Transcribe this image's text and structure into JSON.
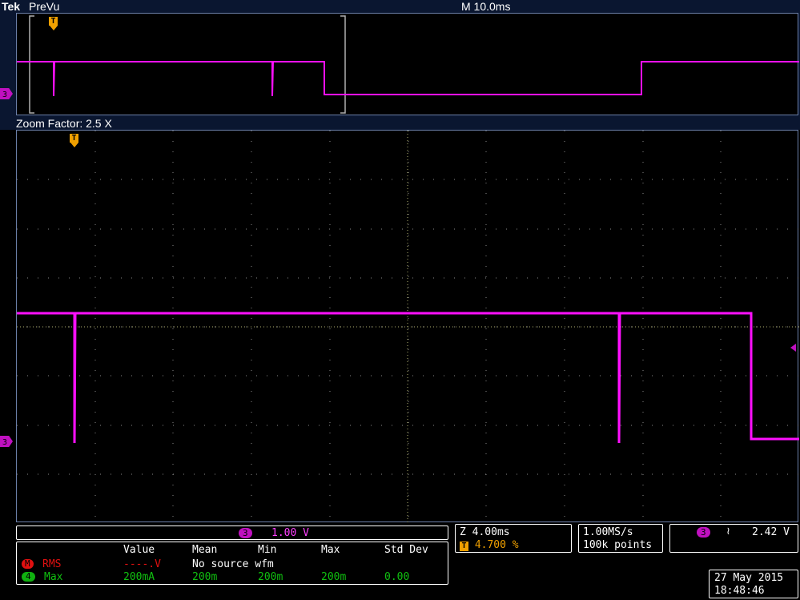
{
  "header": {
    "brand": "Tek",
    "mode": "PreVu",
    "timebase": "M 10.0ms"
  },
  "zoom": {
    "label": "Zoom Factor: 2.5 X"
  },
  "markers": {
    "trigger": "T",
    "channel": "3"
  },
  "channel_readout": {
    "channel": "3",
    "scale": "1.00 V"
  },
  "zoom_readout": {
    "zoom_time": "Z 4.00ms",
    "trigger_badge": "T",
    "trigger_pos": "4.700 %"
  },
  "acquisition": {
    "sample_rate": "1.00MS/s",
    "record_length": "100k points"
  },
  "trigger_readout": {
    "channel": "3",
    "slope_symbol": "≀",
    "level": "2.42 V"
  },
  "measurements": {
    "headers": [
      "Value",
      "Mean",
      "Min",
      "Max",
      "Std Dev"
    ],
    "rows": [
      {
        "badge": "M",
        "name": "RMS",
        "value": "----.V",
        "note": "No source wfm",
        "mean": "",
        "min": "",
        "max": "",
        "std": ""
      },
      {
        "badge": "4",
        "name": "Max",
        "value": "200mA",
        "note": "",
        "mean": "200m",
        "min": "200m",
        "max": "200m",
        "std": "0.00"
      }
    ]
  },
  "datetime": {
    "date": "27 May 2015",
    "time": "18:48:46"
  },
  "colors": {
    "frame_blue": "#3a5a9a",
    "trace_magenta": "#ff10ff",
    "trigger_orange": "#f0a000",
    "measure_red": "#e01010",
    "measure_green": "#10b010"
  }
}
